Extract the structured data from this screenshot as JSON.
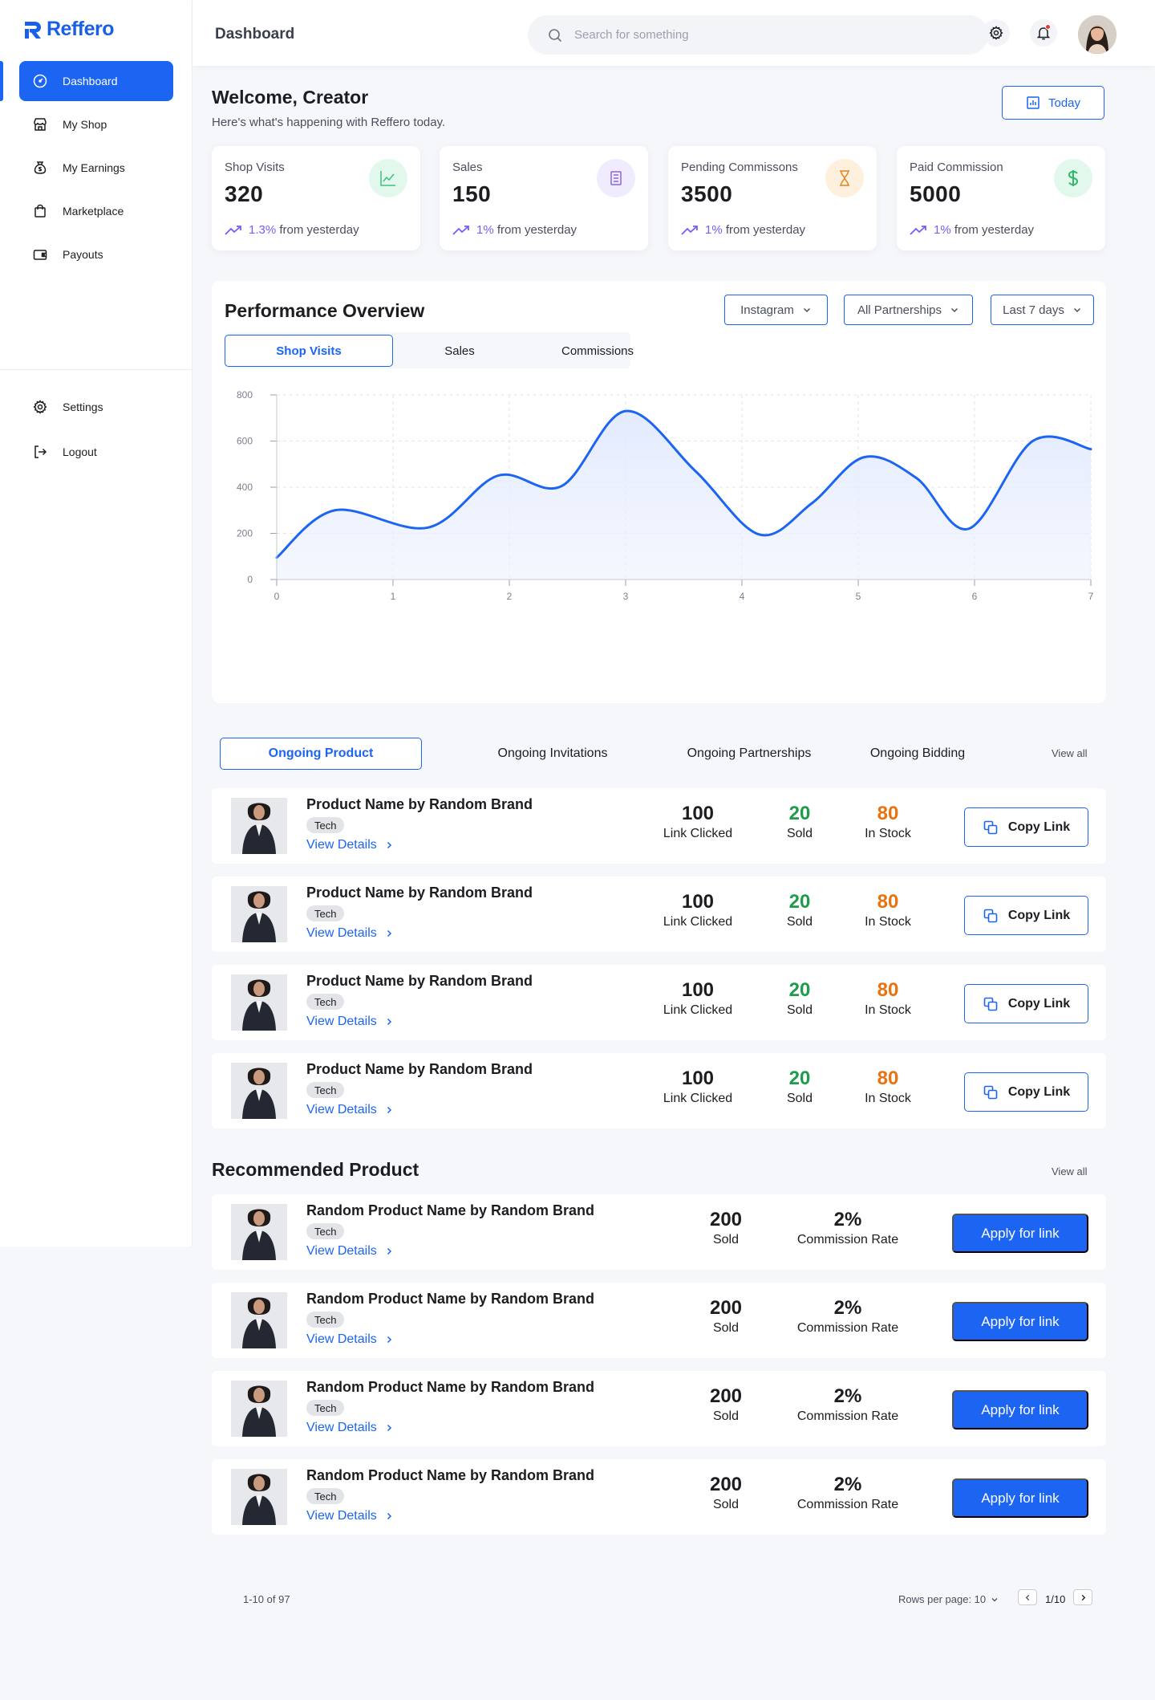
{
  "brand": {
    "name": "Reffero",
    "accent": "#1c64f2"
  },
  "sidebar": {
    "items": [
      {
        "label": "Dashboard",
        "icon": "gauge-icon",
        "active": true
      },
      {
        "label": "My Shop",
        "icon": "store-icon"
      },
      {
        "label": "My Earnings",
        "icon": "money-bag-icon"
      },
      {
        "label": "Marketplace",
        "icon": "shopping-bag-icon"
      },
      {
        "label": "Payouts",
        "icon": "wallet-icon"
      }
    ],
    "bottom": [
      {
        "label": "Settings",
        "icon": "gear-icon"
      },
      {
        "label": "Logout",
        "icon": "logout-icon"
      }
    ]
  },
  "header": {
    "title": "Dashboard",
    "search_placeholder": "Search for something"
  },
  "welcome": {
    "title": "Welcome, Creator",
    "subtitle": "Here's what's happening with Reffero today.",
    "today_label": "Today"
  },
  "stats": [
    {
      "label": "Shop Visits",
      "value": "320",
      "pct": "1.3%",
      "suffix": "from yesterday",
      "icon": "chart-line-icon",
      "icon_bg": "#e3f8ec",
      "icon_color": "#3cc27a"
    },
    {
      "label": "Sales",
      "value": "150",
      "pct": "1%",
      "suffix": "from yesterday",
      "icon": "receipt-icon",
      "icon_bg": "#f1ecfd",
      "icon_color": "#8a63e8"
    },
    {
      "label": "Pending Commissons",
      "value": "3500",
      "pct": "1%",
      "suffix": "from yesterday",
      "icon": "hourglass-icon",
      "icon_bg": "#fdf1de",
      "icon_color": "#e7872b"
    },
    {
      "label": "Paid Commission",
      "value": "5000",
      "pct": "1%",
      "suffix": "from yesterday",
      "icon": "dollar-icon",
      "icon_bg": "#e3f8ec",
      "icon_color": "#2fb865"
    }
  ],
  "performance": {
    "title": "Performance Overview",
    "filters": [
      "Instagram",
      "All Partnerships",
      "Last 7 days"
    ],
    "tabs": [
      "Shop Visits",
      "Sales",
      "Commissions"
    ],
    "active_tab": 0
  },
  "chart_data": {
    "type": "area",
    "x": [
      0,
      0.5,
      1.3,
      1.9,
      2.45,
      3.0,
      3.6,
      4.15,
      4.6,
      5.05,
      5.5,
      5.95,
      6.5,
      7.0
    ],
    "y": [
      95,
      300,
      225,
      450,
      405,
      730,
      470,
      195,
      330,
      530,
      440,
      220,
      600,
      565
    ],
    "x_ticks": [
      "0",
      "1",
      "2",
      "3",
      "4",
      "5",
      "6",
      "7"
    ],
    "y_ticks": [
      "0",
      "200",
      "400",
      "600",
      "800"
    ],
    "xlim": [
      0,
      7
    ],
    "ylim": [
      0,
      800
    ],
    "grid": true,
    "line_color": "#1c64f2"
  },
  "ongoing": {
    "tabs": [
      "Ongoing Product",
      "Ongoing Invitations",
      "Ongoing Partnerships",
      "Ongoing Bidding"
    ],
    "active_tab": 0,
    "view_all": "View all",
    "items": [
      {
        "name": "Product Name by Random Brand",
        "tag": "Tech",
        "details": "View Details",
        "clicked": "100",
        "clicked_label": "Link Clicked",
        "sold": "20",
        "sold_label": "Sold",
        "stock": "80",
        "stock_label": "In Stock",
        "button": "Copy Link"
      },
      {
        "name": "Product Name by Random Brand",
        "tag": "Tech",
        "details": "View Details",
        "clicked": "100",
        "clicked_label": "Link Clicked",
        "sold": "20",
        "sold_label": "Sold",
        "stock": "80",
        "stock_label": "In Stock",
        "button": "Copy Link"
      },
      {
        "name": "Product Name by Random Brand",
        "tag": "Tech",
        "details": "View Details",
        "clicked": "100",
        "clicked_label": "Link Clicked",
        "sold": "20",
        "sold_label": "Sold",
        "stock": "80",
        "stock_label": "In Stock",
        "button": "Copy Link"
      },
      {
        "name": "Product Name by Random Brand",
        "tag": "Tech",
        "details": "View Details",
        "clicked": "100",
        "clicked_label": "Link Clicked",
        "sold": "20",
        "sold_label": "Sold",
        "stock": "80",
        "stock_label": "In Stock",
        "button": "Copy Link"
      }
    ],
    "sold_color": "#1e9c4b",
    "stock_color": "#e8730f"
  },
  "recommended": {
    "title": "Recommended Product",
    "view_all": "View all",
    "items": [
      {
        "name": "Random Product Name by Random Brand",
        "tag": "Tech",
        "details": "View Details",
        "sold": "200",
        "sold_label": "Sold",
        "rate": "2%",
        "rate_label": "Commission Rate",
        "button": "Apply for link"
      },
      {
        "name": "Random Product Name by Random Brand",
        "tag": "Tech",
        "details": "View Details",
        "sold": "200",
        "sold_label": "Sold",
        "rate": "2%",
        "rate_label": "Commission Rate",
        "button": "Apply for link"
      },
      {
        "name": "Random Product Name by Random Brand",
        "tag": "Tech",
        "details": "View Details",
        "sold": "200",
        "sold_label": "Sold",
        "rate": "2%",
        "rate_label": "Commission Rate",
        "button": "Apply for link"
      },
      {
        "name": "Random Product Name by Random Brand",
        "tag": "Tech",
        "details": "View Details",
        "sold": "200",
        "sold_label": "Sold",
        "rate": "2%",
        "rate_label": "Commission Rate",
        "button": "Apply for link"
      }
    ]
  },
  "pagination": {
    "count": "1-10 of 97",
    "rows_per_page": "Rows per page: 10",
    "page": "1/10"
  }
}
